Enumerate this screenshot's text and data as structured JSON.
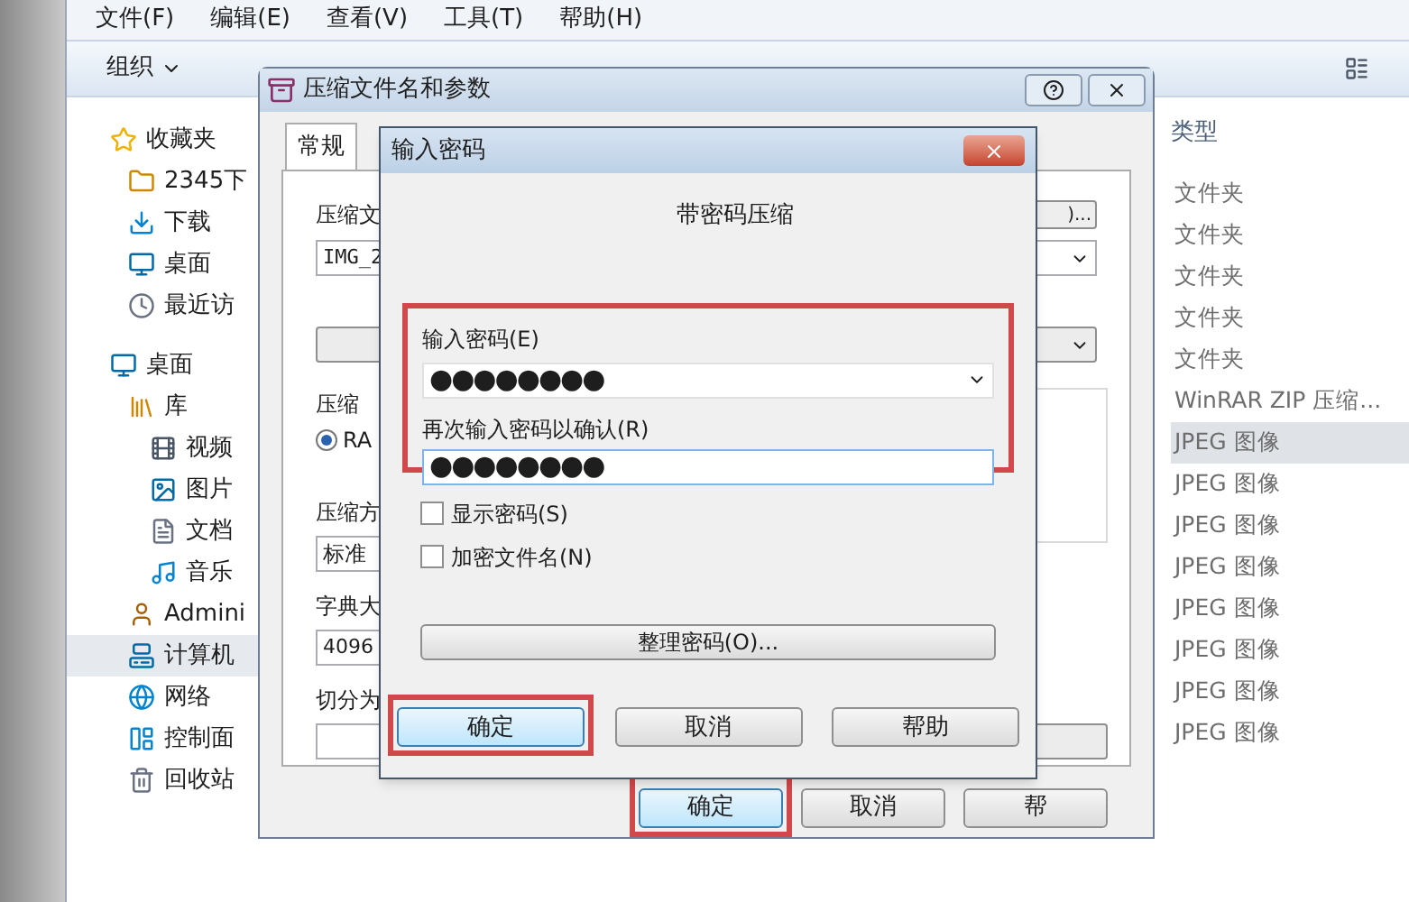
{
  "explorer": {
    "menu": [
      "文件(F)",
      "编辑(E)",
      "查看(V)",
      "工具(T)",
      "帮助(H)"
    ],
    "toolbar": {
      "organize": "组织"
    },
    "nav": [
      {
        "label": "收藏夹",
        "kind": "star",
        "selected": false,
        "children": [
          {
            "label": "2345下",
            "kind": "folder",
            "selected": false
          },
          {
            "label": "下载",
            "kind": "download",
            "selected": false
          },
          {
            "label": "桌面",
            "kind": "desktop",
            "selected": false
          },
          {
            "label": "最近访",
            "kind": "recent",
            "selected": false
          }
        ]
      },
      {
        "label": "桌面",
        "kind": "desktop",
        "selected": false,
        "children": [
          {
            "label": "库",
            "kind": "library",
            "selected": false,
            "children": [
              {
                "label": "视频",
                "kind": "video",
                "selected": false
              },
              {
                "label": "图片",
                "kind": "picture",
                "selected": false
              },
              {
                "label": "文档",
                "kind": "document",
                "selected": false
              },
              {
                "label": "音乐",
                "kind": "music",
                "selected": false
              }
            ]
          },
          {
            "label": "Admini",
            "kind": "user",
            "selected": false
          },
          {
            "label": "计算机",
            "kind": "computer",
            "selected": true
          },
          {
            "label": "网络",
            "kind": "network",
            "selected": false
          },
          {
            "label": "控制面",
            "kind": "control",
            "selected": false
          },
          {
            "label": "回收站",
            "kind": "recycle",
            "selected": false
          }
        ]
      }
    ],
    "details": {
      "column": "类型",
      "rows": [
        {
          "text": "文件夹",
          "selected": false
        },
        {
          "text": "文件夹",
          "selected": false
        },
        {
          "text": "文件夹",
          "selected": false
        },
        {
          "text": "文件夹",
          "selected": false
        },
        {
          "text": "文件夹",
          "selected": false
        },
        {
          "text": "WinRAR ZIP 压缩...",
          "selected": false
        },
        {
          "text": "JPEG 图像",
          "selected": true
        },
        {
          "text": "JPEG 图像",
          "selected": false
        },
        {
          "text": "JPEG 图像",
          "selected": false
        },
        {
          "text": "JPEG 图像",
          "selected": false
        },
        {
          "text": "JPEG 图像",
          "selected": false
        },
        {
          "text": "JPEG 图像",
          "selected": false
        },
        {
          "text": "JPEG 图像",
          "selected": false
        },
        {
          "text": "JPEG 图像",
          "selected": false
        }
      ]
    }
  },
  "archive_dialog": {
    "title": "压缩文件名和参数",
    "tabs": [
      {
        "label": "常规",
        "selected": true
      }
    ],
    "archive_name_label": "压缩文",
    "browse_button": ")...",
    "archive_name": "IMG_2",
    "group_label": "压缩",
    "format_option": {
      "label": "RA",
      "selected": true
    },
    "method_label": "压缩方",
    "method": "标准",
    "dictionary_label": "字典大",
    "dictionary": "4096",
    "split_label": "切分为",
    "buttons": [
      {
        "label": "确定",
        "highlighted": true
      },
      {
        "label": "取消",
        "highlighted": false
      },
      {
        "label": "帮",
        "highlighted": false
      }
    ]
  },
  "password_dialog": {
    "title": "输入密码",
    "heading": "带密码压缩",
    "fields_highlighted": true,
    "password_label": "输入密码(E)",
    "password": "●●●●●●●●",
    "confirm_label": "再次输入密码以确认(R)",
    "confirm": "●●●●●●●●",
    "options": [
      {
        "label": "显示密码(S)",
        "checked": false
      },
      {
        "label": "加密文件名(N)",
        "checked": false
      }
    ],
    "organize_button": "整理密码(O)...",
    "buttons": [
      {
        "label": "确定",
        "highlighted": true
      },
      {
        "label": "取消",
        "highlighted": false
      },
      {
        "label": "帮助",
        "highlighted": false
      }
    ]
  }
}
